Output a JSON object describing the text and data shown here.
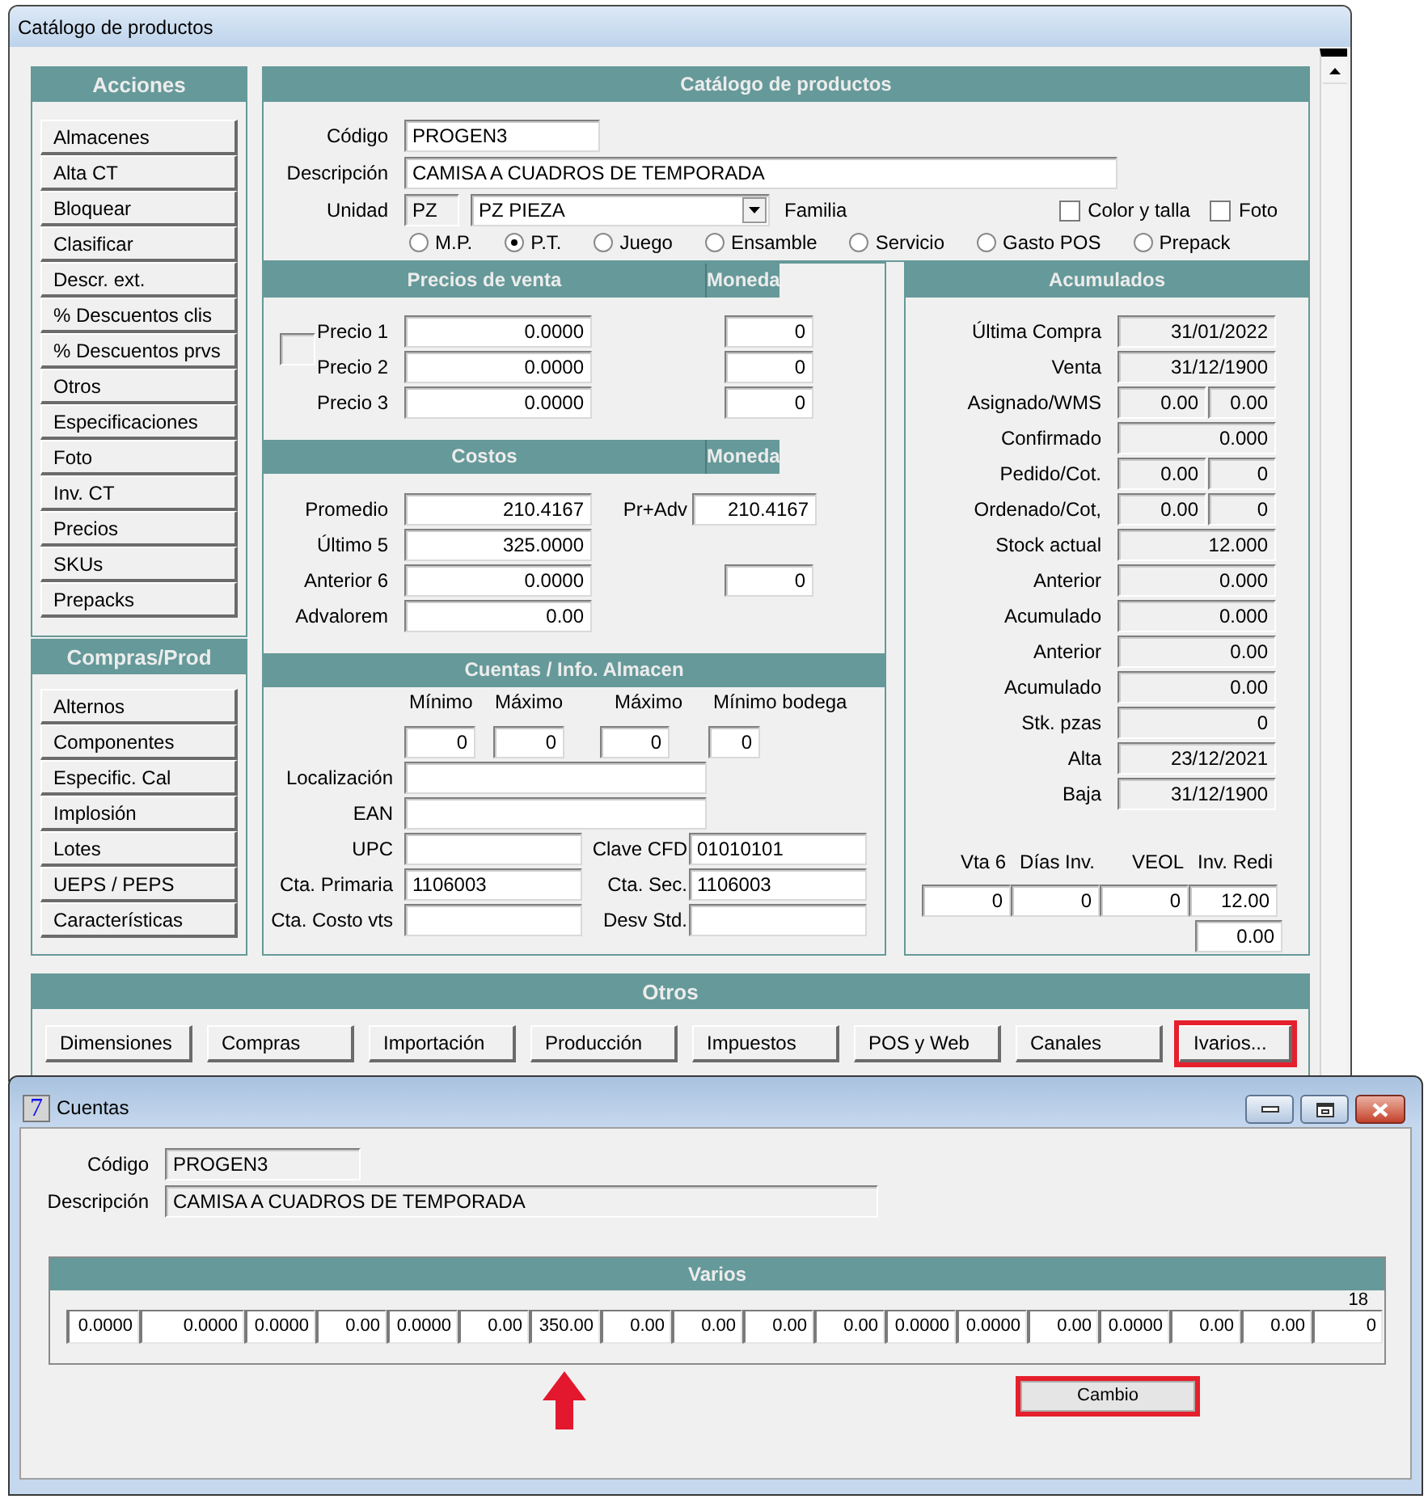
{
  "main_window": {
    "title": "Catálogo de productos"
  },
  "acciones": {
    "title": "Acciones",
    "buttons": [
      "Almacenes",
      "Alta CT",
      "Bloquear",
      "Clasificar",
      "Descr. ext.",
      "% Descuentos clis",
      "% Descuentos prvs",
      "Otros",
      "Especificaciones",
      "Foto",
      "Inv. CT",
      "Precios",
      "SKUs",
      "Prepacks"
    ]
  },
  "compras_prod": {
    "title": "Compras/Prod",
    "buttons": [
      "Alternos",
      "Componentes",
      "Especific. Cal",
      "Implosión",
      "Lotes",
      "UEPS / PEPS",
      "Características"
    ]
  },
  "catalogo": {
    "title": "Catálogo de productos",
    "codigo": {
      "label": "Código",
      "value": "PROGEN3"
    },
    "descripcion": {
      "label": "Descripción",
      "value": "CAMISA A CUADROS DE TEMPORADA"
    },
    "unidad": {
      "label": "Unidad",
      "code": "PZ",
      "value": "PZ PIEZA"
    },
    "familia_label": "Familia",
    "checkboxes": [
      {
        "label": "Color y talla",
        "checked": false
      },
      {
        "label": "Foto",
        "checked": false
      }
    ],
    "types": [
      {
        "label": "M.P.",
        "selected": false
      },
      {
        "label": "P.T.",
        "selected": true
      },
      {
        "label": "Juego",
        "selected": false
      },
      {
        "label": "Ensamble",
        "selected": false
      },
      {
        "label": "Servicio",
        "selected": false
      },
      {
        "label": "Gasto POS",
        "selected": false
      },
      {
        "label": "Prepack",
        "selected": false
      }
    ]
  },
  "precios_de_venta": {
    "title": "Precios de venta",
    "currency_title": "Moneda",
    "rows": [
      {
        "label": "Precio 1",
        "value": "0.0000",
        "currency": "0"
      },
      {
        "label": "Precio 2",
        "value": "0.0000",
        "currency": "0"
      },
      {
        "label": "Precio 3",
        "value": "0.0000",
        "currency": "0"
      }
    ]
  },
  "costos": {
    "title": "Costos",
    "currency_title": "Moneda",
    "rows": [
      {
        "label": "Promedio",
        "value": "210.4167",
        "extra": {
          "label": "Pr+Adv",
          "value": "210.4167"
        }
      },
      {
        "label": "Último 5",
        "value": "325.0000"
      },
      {
        "label": "Anterior 6",
        "value": "0.0000",
        "currency": "0"
      },
      {
        "label": "Advalorem",
        "value": "0.00"
      }
    ]
  },
  "cuentas_info": {
    "title": "Cuentas / Info. Almacen",
    "limits": [
      {
        "label": "Mínimo",
        "value": "0"
      },
      {
        "label": "Máximo",
        "value": "0"
      },
      {
        "label": "Máximo",
        "value": "0"
      },
      {
        "label": "Mínimo bodega",
        "value": "0"
      }
    ],
    "fields": [
      {
        "label": "Localización",
        "kind": "wide"
      },
      {
        "label": "EAN",
        "kind": "wide"
      },
      {
        "label": "UPC",
        "kind": "pair",
        "pair": {
          "label": "Clave CFD",
          "value": "01010101"
        }
      },
      {
        "label": "Cta. Primaria",
        "value": "1106003",
        "kind": "pair",
        "pair": {
          "label": "Cta. Sec.",
          "value": "1106003"
        }
      },
      {
        "label": "Cta. Costo vts",
        "kind": "pair",
        "pair": {
          "label": "Desv Std."
        }
      }
    ]
  },
  "acumulados": {
    "title": "Acumulados",
    "rows": [
      {
        "label": "Última Compra",
        "values": [
          "31/01/2022"
        ]
      },
      {
        "label": "Venta",
        "values": [
          "31/12/1900"
        ]
      },
      {
        "label": "Asignado/WMS",
        "values": [
          "0.00",
          "0.00"
        ]
      },
      {
        "label": "Confirmado",
        "values": [
          "0.000"
        ]
      },
      {
        "label": "Pedido/Cot.",
        "values": [
          "0.00",
          "0"
        ]
      },
      {
        "label": "Ordenado/Cot,",
        "values": [
          "0.00",
          "0"
        ]
      },
      {
        "label": "Stock actual",
        "values": [
          "12.000"
        ]
      },
      {
        "label": "Anterior",
        "values": [
          "0.000"
        ]
      },
      {
        "label": "Acumulado",
        "values": [
          "0.000"
        ]
      },
      {
        "label": "Anterior",
        "values": [
          "0.00"
        ]
      },
      {
        "label": "Acumulado",
        "values": [
          "0.00"
        ]
      },
      {
        "label": "Stk. pzas",
        "values": [
          "0"
        ]
      },
      {
        "label": "Alta",
        "values": [
          "23/12/2021"
        ]
      },
      {
        "label": "Baja",
        "values": [
          "31/12/1900"
        ]
      }
    ],
    "stats": [
      {
        "label": "Vta 6",
        "value": "0"
      },
      {
        "label": "Días Inv.",
        "value": "0"
      },
      {
        "label": "VEOL",
        "value": "0"
      },
      {
        "label": "Inv. Redi",
        "value": "12.00"
      }
    ],
    "extra_value": "0.00"
  },
  "otros": {
    "title": "Otros",
    "buttons": [
      {
        "label": "Dimensiones",
        "highlighted": false
      },
      {
        "label": "Compras",
        "highlighted": false
      },
      {
        "label": "Importación",
        "highlighted": false
      },
      {
        "label": "Producción",
        "highlighted": false
      },
      {
        "label": "Impuestos",
        "highlighted": false
      },
      {
        "label": "POS y Web",
        "highlighted": false
      },
      {
        "label": "Canales",
        "highlighted": false
      },
      {
        "label": "Ivarios...",
        "highlighted": true
      }
    ]
  },
  "cuentas_window": {
    "icon": "7",
    "title": "Cuentas",
    "fields": [
      {
        "label": "Código",
        "value": "PROGEN3"
      },
      {
        "label": "Descripción",
        "value": "CAMISA A CUADROS DE TEMPORADA"
      }
    ],
    "varios": {
      "title": "Varios",
      "counter": "18",
      "values": [
        {
          "value": "0.0000",
          "marked": false
        },
        {
          "value": "0.0000",
          "marked": false
        },
        {
          "value": "0.0000",
          "marked": false
        },
        {
          "value": "0.00",
          "marked": false
        },
        {
          "value": "0.0000",
          "marked": false
        },
        {
          "value": "0.00",
          "marked": false
        },
        {
          "value": "350.00",
          "marked": true
        },
        {
          "value": "0.00",
          "marked": false
        },
        {
          "value": "0.00",
          "marked": false
        },
        {
          "value": "0.00",
          "marked": false
        },
        {
          "value": "0.00",
          "marked": false
        },
        {
          "value": "0.0000",
          "marked": false
        },
        {
          "value": "0.0000",
          "marked": false
        },
        {
          "value": "0.00",
          "marked": false
        },
        {
          "value": "0.0000",
          "marked": false
        },
        {
          "value": "0.00",
          "marked": false
        },
        {
          "value": "0.00",
          "marked": false
        },
        {
          "value": "0",
          "marked": false
        }
      ]
    },
    "button": {
      "label": "Cambio",
      "highlighted": true
    }
  }
}
